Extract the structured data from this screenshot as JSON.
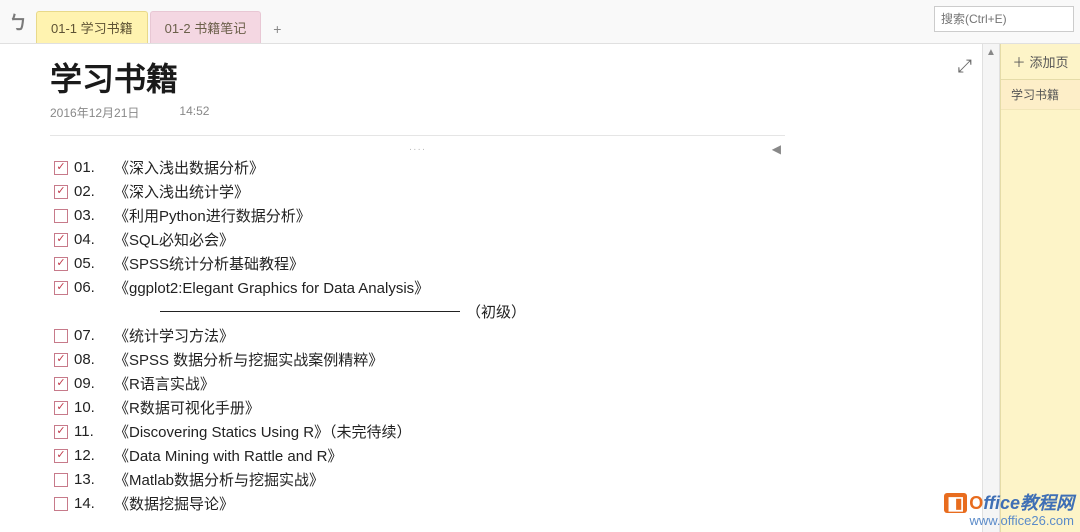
{
  "tabs": [
    {
      "label": "01-1 学习书籍",
      "active": true
    },
    {
      "label": "01-2 书籍笔记",
      "active": false
    }
  ],
  "add_tab": "+",
  "search_placeholder": "搜索(Ctrl+E)",
  "page_title": "学习书籍",
  "date": "2016年12月21日",
  "time": "14:52",
  "divider_label": "（初级）",
  "items": [
    {
      "num": "01.",
      "title": "《深入浅出数据分析》",
      "checked": true
    },
    {
      "num": "02.",
      "title": "《深入浅出统计学》",
      "checked": true
    },
    {
      "num": "03.",
      "title": "《利用Python进行数据分析》",
      "checked": false
    },
    {
      "num": "04.",
      "title": "《SQL必知必会》",
      "checked": true
    },
    {
      "num": "05.",
      "title": "《SPSS统计分析基础教程》",
      "checked": true
    },
    {
      "num": "06.",
      "title": "《ggplot2:Elegant Graphics for Data Analysis》",
      "checked": true
    },
    {
      "num": "07.",
      "title": "《统计学习方法》",
      "checked": false
    },
    {
      "num": "08.",
      "title": "《SPSS 数据分析与挖掘实战案例精粹》",
      "checked": true
    },
    {
      "num": "09.",
      "title": "《R语言实战》",
      "checked": true
    },
    {
      "num": "10.",
      "title": "《R数据可视化手册》",
      "checked": true
    },
    {
      "num": "11.",
      "title": "《Discovering Statics Using R》（未完待续）",
      "checked": true
    },
    {
      "num": "12.",
      "title": "《Data Mining with Rattle and R》",
      "checked": true
    },
    {
      "num": "13.",
      "title": "《Matlab数据分析与挖掘实战》",
      "checked": false
    },
    {
      "num": "14.",
      "title": "《数据挖掘导论》",
      "checked": false
    }
  ],
  "sidebar": {
    "add_page": "添加页",
    "items": [
      "学习书籍"
    ]
  },
  "watermark": {
    "brand_prefix": "O",
    "brand_text": "ffice教程网",
    "url": "www.office26.com"
  }
}
